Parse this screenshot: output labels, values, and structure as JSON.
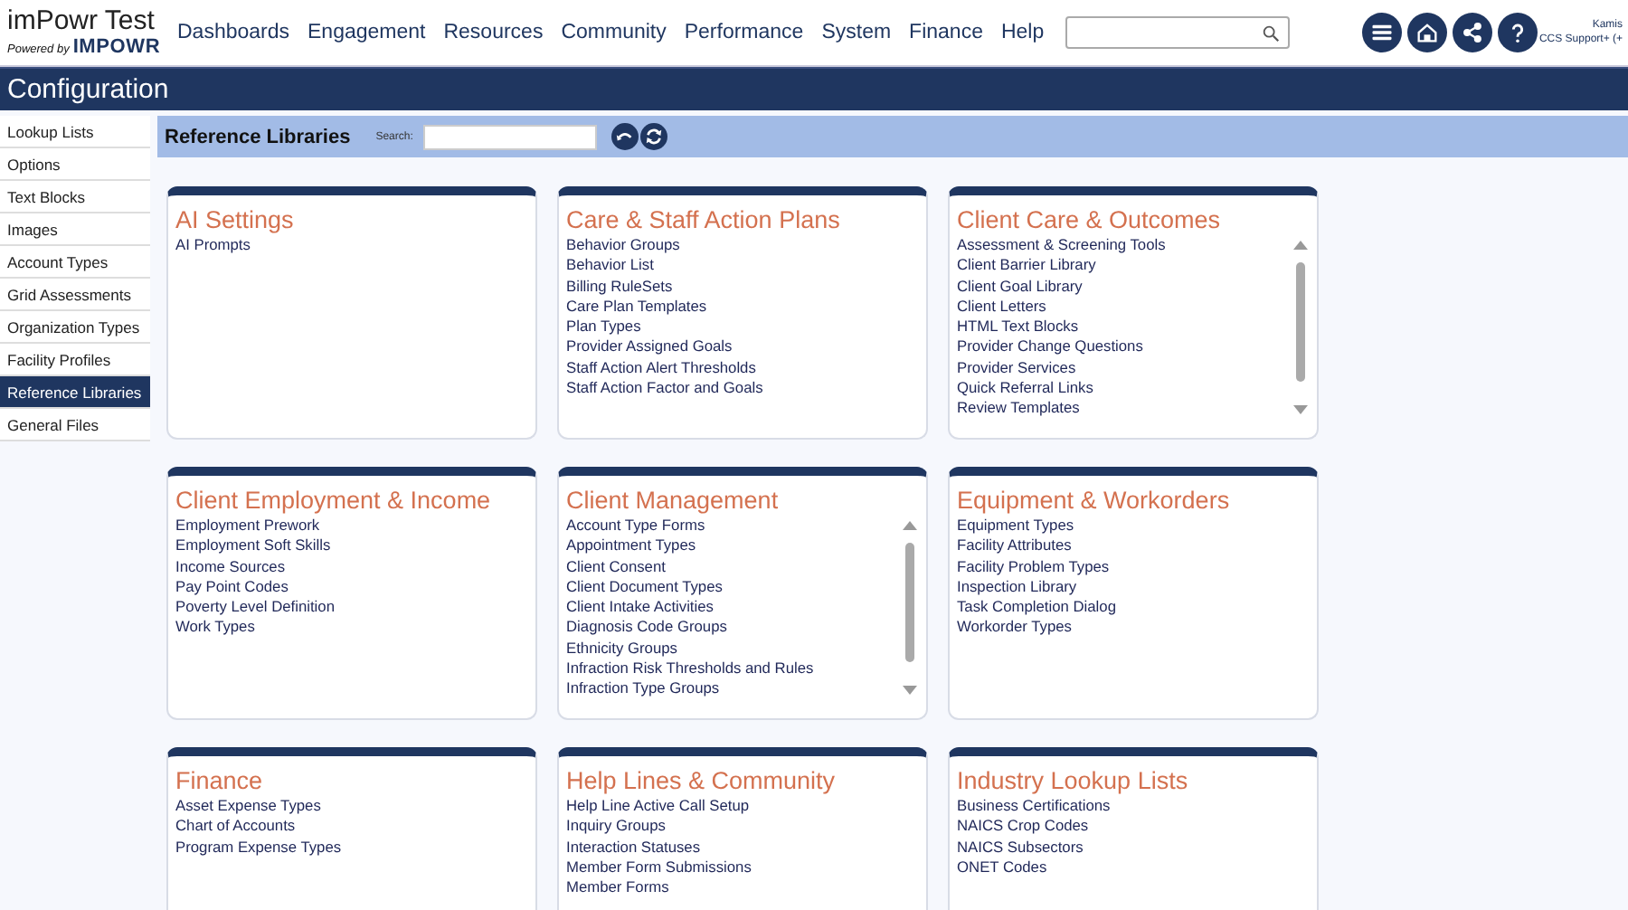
{
  "brand": {
    "title": "imPowr Test",
    "powered_by": "Powered by",
    "logo_text": "IMPOWR"
  },
  "nav": [
    "Dashboards",
    "Engagement",
    "Resources",
    "Community",
    "Performance",
    "System",
    "Finance",
    "Help"
  ],
  "user": {
    "name": "Kamis",
    "role": "CCS Support+ (+"
  },
  "page_title": "Configuration",
  "sidebar": {
    "items": [
      {
        "label": "Lookup Lists",
        "selected": false
      },
      {
        "label": "Options",
        "selected": false
      },
      {
        "label": "Text Blocks",
        "selected": false
      },
      {
        "label": "Images",
        "selected": false
      },
      {
        "label": "Account Types",
        "selected": false
      },
      {
        "label": "Grid Assessments",
        "selected": false
      },
      {
        "label": "Organization Types",
        "selected": false
      },
      {
        "label": "Facility Profiles",
        "selected": false
      },
      {
        "label": "Reference Libraries",
        "selected": true
      },
      {
        "label": "General Files",
        "selected": false
      }
    ]
  },
  "toolbar": {
    "title": "Reference Libraries",
    "search_label": "Search:"
  },
  "cards": [
    {
      "title": "AI Settings",
      "scrollbar": false,
      "items": [
        "AI Prompts"
      ]
    },
    {
      "title": "Care & Staff Action Plans",
      "scrollbar": false,
      "items": [
        "Behavior Groups",
        "Behavior List",
        "Billing RuleSets",
        "Care Plan Templates",
        "Plan Types",
        "Provider Assigned Goals",
        "Staff Action Alert Thresholds",
        "Staff Action Factor and Goals"
      ]
    },
    {
      "title": "Client Care & Outcomes",
      "scrollbar": true,
      "items": [
        "Assessment & Screening Tools",
        "Client Barrier Library",
        "Client Goal Library",
        "Client Letters",
        "HTML Text Blocks",
        "Provider Change Questions",
        "Provider Services",
        "Quick Referral Links",
        "Review Templates"
      ]
    },
    {
      "title": "Client Employment & Income",
      "scrollbar": false,
      "items": [
        "Employment Prework",
        "Employment Soft Skills",
        "Income Sources",
        "Pay Point Codes",
        "Poverty Level Definition",
        "Work Types"
      ]
    },
    {
      "title": "Client Management",
      "scrollbar": true,
      "items": [
        "Account Type Forms",
        "Appointment Types",
        "Client Consent",
        "Client Document Types",
        "Client Intake Activities",
        "Diagnosis Code Groups",
        "Ethnicity Groups",
        "Infraction Risk Thresholds and Rules",
        "Infraction Type Groups"
      ]
    },
    {
      "title": "Equipment & Workorders",
      "scrollbar": false,
      "items": [
        "Equipment Types",
        "Facility Attributes",
        "Facility Problem Types",
        "Inspection Library",
        "Task Completion Dialog",
        "Workorder Types"
      ]
    },
    {
      "title": "Finance",
      "scrollbar": false,
      "items": [
        "Asset Expense Types",
        "Chart of Accounts",
        "Program Expense Types"
      ]
    },
    {
      "title": "Help Lines & Community",
      "scrollbar": false,
      "items": [
        "Help Line Active Call Setup",
        "Inquiry Groups",
        "Interaction Statuses",
        "Member Form Submissions",
        "Member Forms"
      ]
    },
    {
      "title": "Industry Lookup Lists",
      "scrollbar": false,
      "items": [
        "Business Certifications",
        "NAICS Crop Codes",
        "NAICS Subsectors",
        "ONET Codes"
      ]
    }
  ]
}
